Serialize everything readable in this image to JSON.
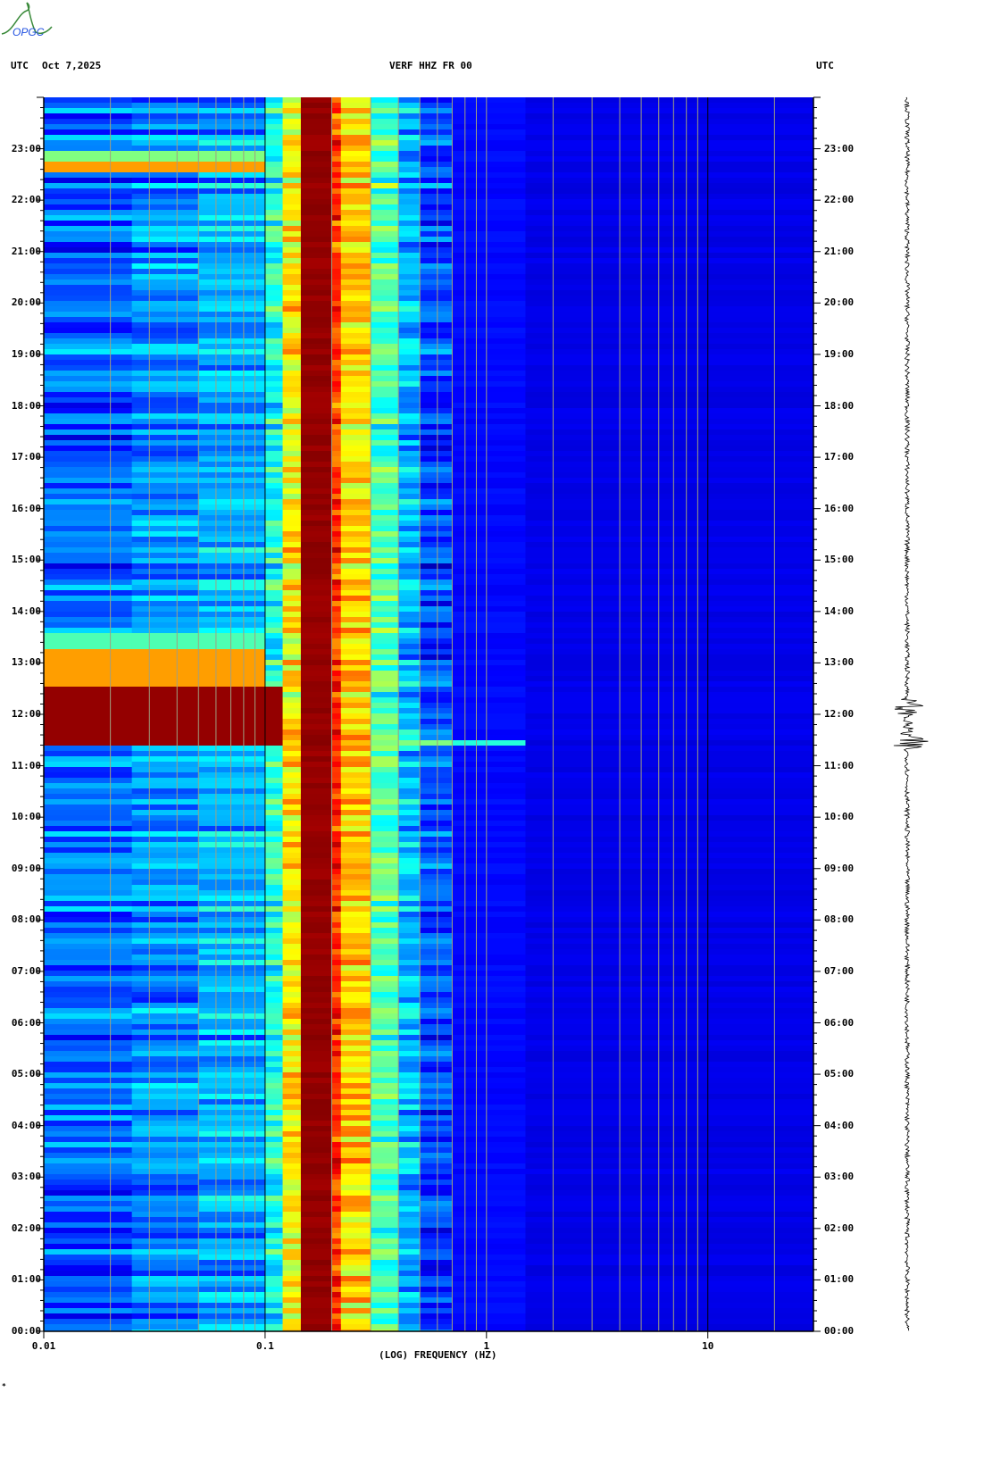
{
  "logo_text": "OPGC",
  "header": {
    "left_tz": "UTC",
    "date": "Oct 7,2025",
    "station": "VERF HHZ FR 00",
    "right_tz": "UTC"
  },
  "footer_mark": "*",
  "chart_data": {
    "type": "heatmap",
    "title": "VERF HHZ FR 00",
    "xlabel": "(LOG) FREQUENCY (HZ)",
    "ylabel": "UTC",
    "xscale": "log",
    "xlim": [
      0.01,
      30
    ],
    "ylim_hours": [
      0,
      24
    ],
    "xticks": [
      {
        "v": 0.01,
        "label": "0.01"
      },
      {
        "v": 0.1,
        "label": "0.1"
      },
      {
        "v": 1,
        "label": "1"
      },
      {
        "v": 10,
        "label": "10"
      }
    ],
    "yticks": [
      "00:00",
      "01:00",
      "02:00",
      "03:00",
      "04:00",
      "05:00",
      "06:00",
      "07:00",
      "08:00",
      "09:00",
      "10:00",
      "11:00",
      "12:00",
      "13:00",
      "14:00",
      "15:00",
      "16:00",
      "17:00",
      "18:00",
      "19:00",
      "20:00",
      "21:00",
      "22:00",
      "23:00"
    ],
    "colormap": "jet",
    "bands": [
      {
        "f0": 0.01,
        "f1": 0.025,
        "level": 0.22
      },
      {
        "f0": 0.025,
        "f1": 0.05,
        "level": 0.26
      },
      {
        "f0": 0.05,
        "f1": 0.1,
        "level": 0.29
      },
      {
        "f0": 0.1,
        "f1": 0.12,
        "level": 0.4
      },
      {
        "f0": 0.12,
        "f1": 0.145,
        "level": 0.63
      },
      {
        "f0": 0.145,
        "f1": 0.2,
        "level": 0.98
      },
      {
        "f0": 0.2,
        "f1": 0.22,
        "level": 0.82
      },
      {
        "f0": 0.22,
        "f1": 0.3,
        "level": 0.66
      },
      {
        "f0": 0.3,
        "f1": 0.4,
        "level": 0.45
      },
      {
        "f0": 0.4,
        "f1": 0.5,
        "level": 0.3
      },
      {
        "f0": 0.5,
        "f1": 0.7,
        "level": 0.19
      },
      {
        "f0": 0.7,
        "f1": 1.5,
        "level": 0.13
      },
      {
        "f0": 1.5,
        "f1": 30,
        "level": 0.1
      }
    ],
    "events": [
      {
        "start": 11.35,
        "end": 12.55,
        "fmax": 0.12,
        "level": 0.98
      },
      {
        "start": 12.55,
        "end": 13.3,
        "fmax": 0.1,
        "level": 0.72
      },
      {
        "start": 13.3,
        "end": 13.6,
        "fmax": 0.1,
        "level": 0.45
      },
      {
        "start": 22.5,
        "end": 22.75,
        "fmax": 0.1,
        "level": 0.72
      },
      {
        "start": 22.75,
        "end": 22.95,
        "fmax": 0.1,
        "level": 0.5
      },
      {
        "start": 11.38,
        "end": 11.48,
        "fmax": 1.5,
        "level": 0.5
      }
    ],
    "trace": {
      "event_start": 11.3,
      "event_end": 12.3,
      "label": "seismogram"
    }
  }
}
